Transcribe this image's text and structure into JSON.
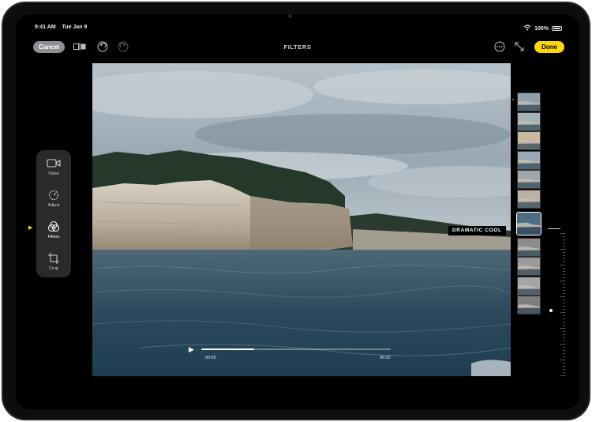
{
  "status": {
    "time": "9:41 AM",
    "date": "Tue Jan 9",
    "battery": "100%"
  },
  "toolbar": {
    "cancel_label": "Cancel",
    "title": "FILTERS",
    "done_label": "Done",
    "icons": [
      "compare-icon",
      "undo-icon",
      "redo-icon",
      "more-icon",
      "crop-aspect-icon"
    ]
  },
  "sidebar": {
    "items": [
      {
        "label": "Video",
        "icon": "video-icon"
      },
      {
        "label": "Adjust",
        "icon": "adjust-icon"
      },
      {
        "label": "Filters",
        "icon": "filters-icon",
        "active": true
      },
      {
        "label": "Crop",
        "icon": "crop-icon"
      }
    ]
  },
  "player": {
    "current_time": "00:00",
    "duration": "00:02",
    "progress": 0.28
  },
  "filters": {
    "selected_name": "DRAMATIC COOL",
    "selected_index": 6,
    "count": 11
  },
  "intensity": {
    "level": 0.55
  },
  "colors": {
    "accent": "#ffd60a",
    "cancel_bg": "#8e8e93",
    "panel_bg": "#2a2a2c"
  }
}
